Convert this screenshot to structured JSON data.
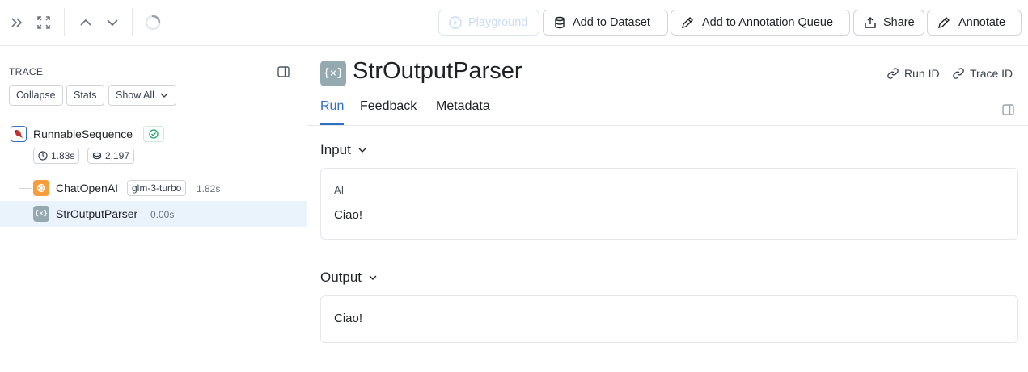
{
  "toolbar": {
    "playground_label": "Playground",
    "add_to_dataset_label": "Add to Dataset",
    "add_to_queue_label": "Add to Annotation Queue",
    "share_label": "Share",
    "annotate_label": "Annotate"
  },
  "trace_panel": {
    "header": "TRACE",
    "collapse_label": "Collapse",
    "stats_label": "Stats",
    "show_all_label": "Show All",
    "root": {
      "name": "RunnableSequence",
      "status": "success",
      "duration": "1.83s",
      "tokens": "2,197"
    },
    "children": [
      {
        "name": "ChatOpenAI",
        "model": "glm-3-turbo",
        "duration": "1.82s"
      },
      {
        "name": "StrOutputParser",
        "duration": "0.00s",
        "selected": true
      }
    ]
  },
  "detail": {
    "icon_text": "{×}",
    "title": "StrOutputParser",
    "run_id_label": "Run ID",
    "trace_id_label": "Trace ID",
    "tabs": [
      "Run",
      "Feedback",
      "Metadata"
    ],
    "active_tab": "Run",
    "input": {
      "title": "Input",
      "role": "AI",
      "message": "Ciao!"
    },
    "output": {
      "title": "Output",
      "message": "Ciao!"
    }
  },
  "colors": {
    "accent": "#2f6fc4",
    "selected_row": "#eaf2fb",
    "success": "#22a06b",
    "openai_orange": "#f59e3b",
    "parser_icon": "#94a9b0"
  }
}
